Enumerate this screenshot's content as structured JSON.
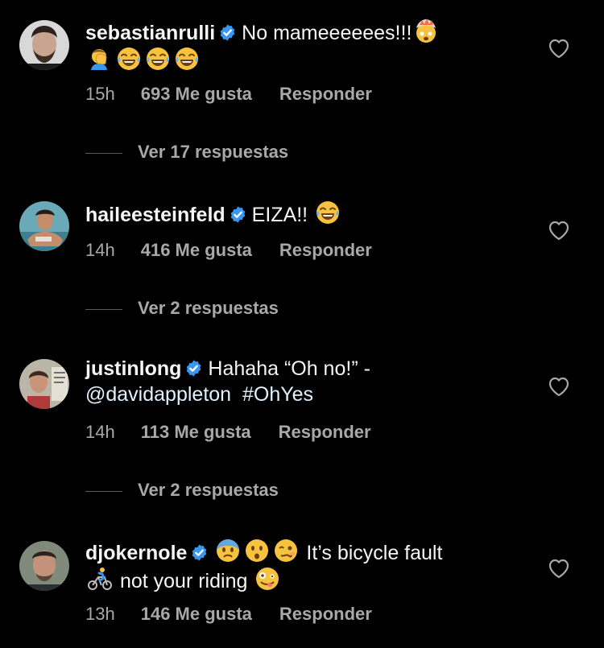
{
  "comments": [
    {
      "username": "sebastianrulli",
      "text": "No mameeeeees!!!",
      "emoji": [
        "exploding-head-emoji",
        "facepalm-emoji",
        "tears-of-joy-emoji",
        "tears-of-joy-emoji",
        "tears-of-joy-emoji"
      ],
      "time": "15h",
      "likes": "693 Me gusta",
      "reply": "Responder",
      "view_replies": "Ver 17 respuestas"
    },
    {
      "username": "haileesteinfeld",
      "text": "EIZA!!",
      "emoji": [
        "tears-of-joy-emoji"
      ],
      "time": "14h",
      "likes": "416 Me gusta",
      "reply": "Responder",
      "view_replies": "Ver 2 respuestas"
    },
    {
      "username": "justinlong",
      "text": "Hahaha “Oh no!” -",
      "mention": "@davidappleton",
      "hashtag": "#OhYes",
      "time": "14h",
      "likes": "113 Me gusta",
      "reply": "Responder",
      "view_replies": "Ver 2 respuestas"
    },
    {
      "username": "djokernole",
      "text": "It’s bicycle fault",
      "text2": "not your riding",
      "emoji": [
        "fearful-emoji",
        "hushed-emoji",
        "woozy-emoji",
        "cyclist-emoji",
        "zany-emoji"
      ],
      "time": "13h",
      "likes": "146 Me gusta",
      "reply": "Responder"
    }
  ],
  "colors": {
    "background": "#000000",
    "text": "#f5f5f5",
    "muted": "#a8a8a8",
    "verified": "#3897f0",
    "link": "#e0f1ff"
  }
}
